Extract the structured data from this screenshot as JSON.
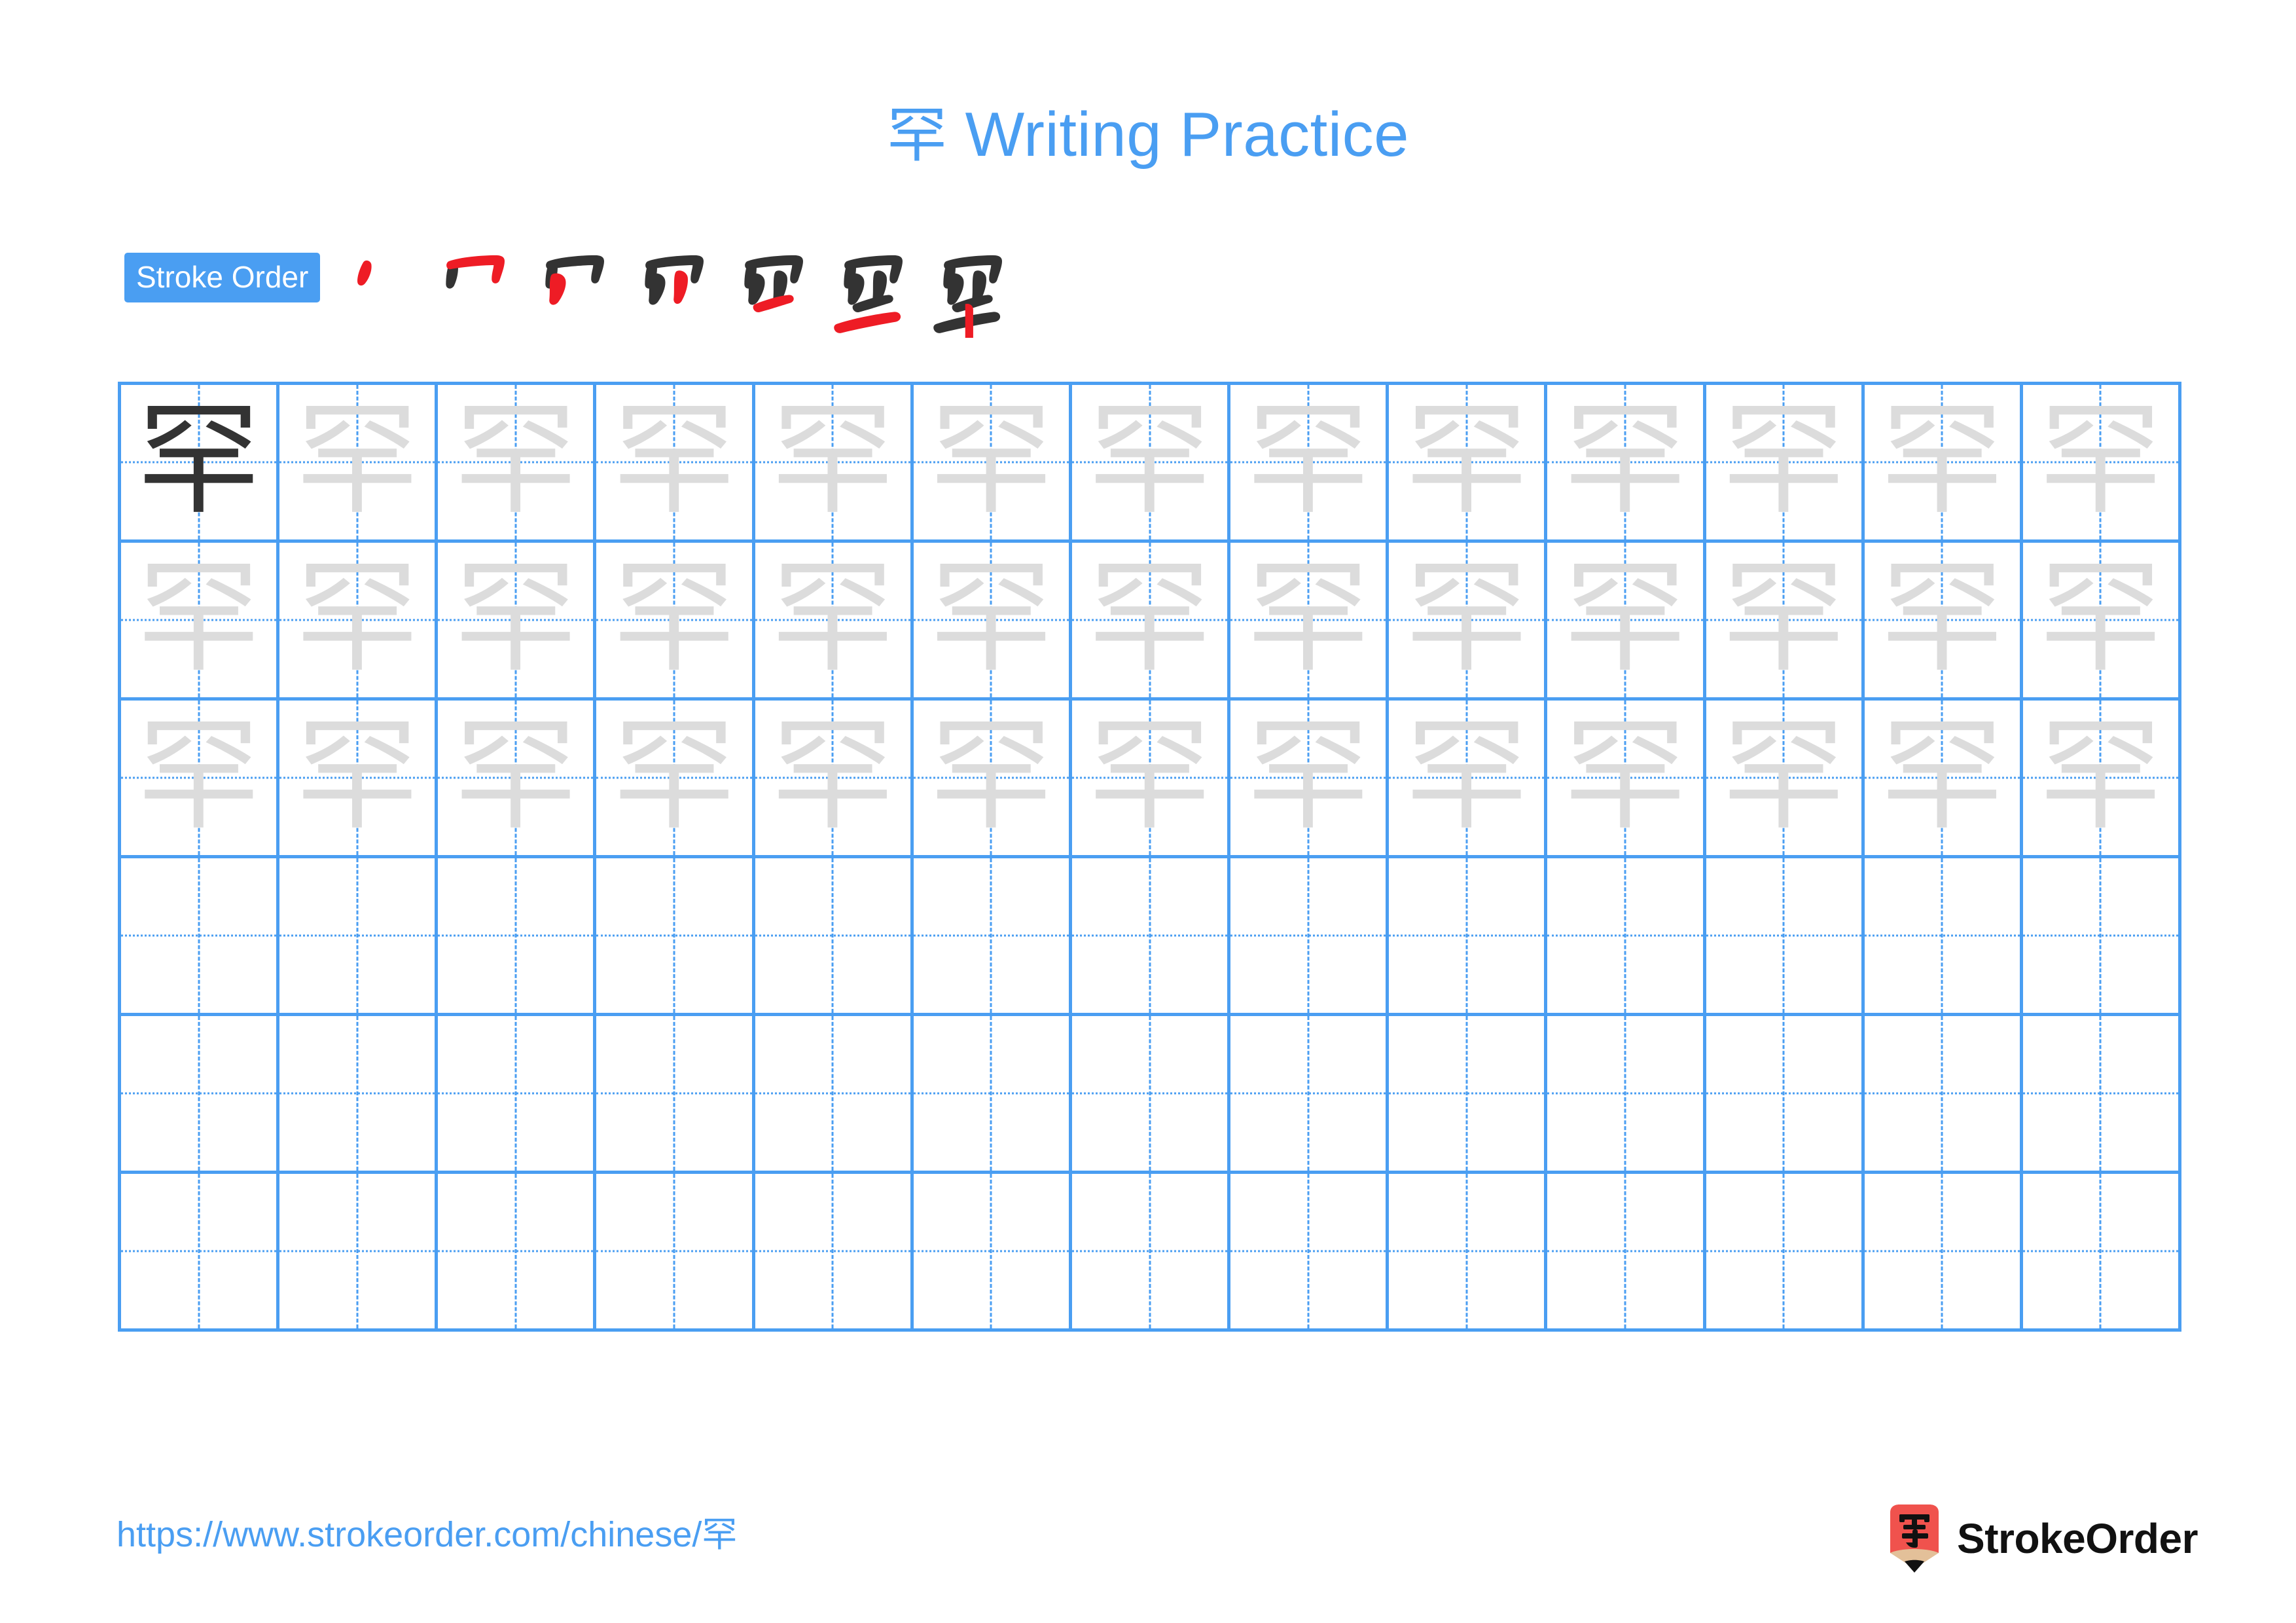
{
  "document": {
    "character": "罕",
    "title_suffix": " Writing Practice",
    "title_full": "罕 Writing Practice"
  },
  "stroke_order": {
    "badge_label": "Stroke Order",
    "total_strokes": 7,
    "steps": [
      {
        "index": 1,
        "strokes_shown": 1,
        "new_stroke_color": "#ee1c25"
      },
      {
        "index": 2,
        "strokes_shown": 2,
        "new_stroke_color": "#ee1c25"
      },
      {
        "index": 3,
        "strokes_shown": 3,
        "new_stroke_color": "#ee1c25"
      },
      {
        "index": 4,
        "strokes_shown": 4,
        "new_stroke_color": "#ee1c25"
      },
      {
        "index": 5,
        "strokes_shown": 5,
        "new_stroke_color": "#ee1c25"
      },
      {
        "index": 6,
        "strokes_shown": 6,
        "new_stroke_color": "#ee1c25"
      },
      {
        "index": 7,
        "strokes_shown": 7,
        "new_stroke_color": "#ee1c25"
      }
    ]
  },
  "practice_grid": {
    "columns": 13,
    "rows": 6,
    "grid_color": "#4a9ef2",
    "model_char_color": "#333333",
    "trace_char_color": "#dcdcdc",
    "cells": [
      [
        "dark",
        "trace",
        "trace",
        "trace",
        "trace",
        "trace",
        "trace",
        "trace",
        "trace",
        "trace",
        "trace",
        "trace",
        "trace"
      ],
      [
        "trace",
        "trace",
        "trace",
        "trace",
        "trace",
        "trace",
        "trace",
        "trace",
        "trace",
        "trace",
        "trace",
        "trace",
        "trace"
      ],
      [
        "trace",
        "trace",
        "trace",
        "trace",
        "trace",
        "trace",
        "trace",
        "trace",
        "trace",
        "trace",
        "trace",
        "trace",
        "trace"
      ],
      [
        "empty",
        "empty",
        "empty",
        "empty",
        "empty",
        "empty",
        "empty",
        "empty",
        "empty",
        "empty",
        "empty",
        "empty",
        "empty"
      ],
      [
        "empty",
        "empty",
        "empty",
        "empty",
        "empty",
        "empty",
        "empty",
        "empty",
        "empty",
        "empty",
        "empty",
        "empty",
        "empty"
      ],
      [
        "empty",
        "empty",
        "empty",
        "empty",
        "empty",
        "empty",
        "empty",
        "empty",
        "empty",
        "empty",
        "empty",
        "empty",
        "empty"
      ]
    ]
  },
  "footer": {
    "url": "https://www.strokeorder.com/chinese/罕",
    "brand_name": "StrokeOrder",
    "logo_character": "字",
    "logo_body_color": "#f0524d",
    "logo_tip_color": "#e3c099"
  },
  "colors": {
    "accent_blue": "#4a9ef2",
    "stroke_red": "#ee1c25",
    "ink_dark": "#333333",
    "trace_gray": "#dcdcdc"
  }
}
